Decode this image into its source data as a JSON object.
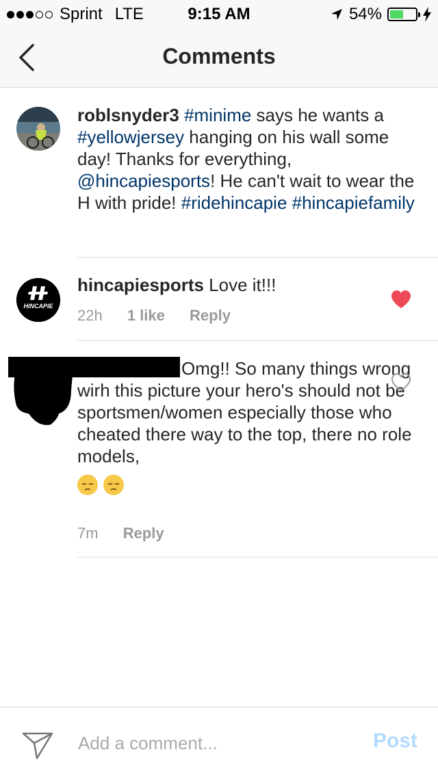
{
  "status_bar": {
    "carrier": "Sprint",
    "network": "LTE",
    "time": "9:15 AM",
    "battery": "54%",
    "battery_level": 0.54,
    "battery_color": "#4cd964"
  },
  "nav": {
    "title": "Comments",
    "back_icon": "chevron-left-icon"
  },
  "caption": {
    "username": "roblsnyder3",
    "parts": [
      {
        "type": "tag",
        "text": "#minime"
      },
      {
        "type": "text",
        "text": " says he wants a "
      },
      {
        "type": "tag",
        "text": "#yellowjersey"
      },
      {
        "type": "text",
        "text": " hanging on his wall some day! Thanks for everything, "
      },
      {
        "type": "tag",
        "text": "@hincapiesports"
      },
      {
        "type": "text",
        "text": "! He can't wait to wear the H with pride! "
      },
      {
        "type": "tag",
        "text": "#ridehincapie"
      },
      {
        "type": "text",
        "text": " "
      },
      {
        "type": "tag",
        "text": "#hincapiefamily"
      }
    ]
  },
  "comments": [
    {
      "username": "hincapiesports",
      "text": "Love it!!!",
      "time": "22h",
      "likes": "1 like",
      "reply_label": "Reply",
      "liked": true,
      "avatar_logo_text": "HINCAPIE"
    },
    {
      "username": "",
      "text": "Omg!! So many things wrong wirh this picture your hero's should not be sportsmen/women especially those who cheated there way to the top, there no role models,",
      "emojis": [
        "pensive-face",
        "pensive-face"
      ],
      "time": "7m",
      "reply_label": "Reply",
      "liked": false
    }
  ],
  "footer": {
    "placeholder": "Add a comment...",
    "post_label": "Post",
    "send_icon": "paper-plane-icon"
  },
  "colors": {
    "hashtag": "#003569",
    "like_red": "#ed4956",
    "post_disabled": "#b3dbff"
  }
}
